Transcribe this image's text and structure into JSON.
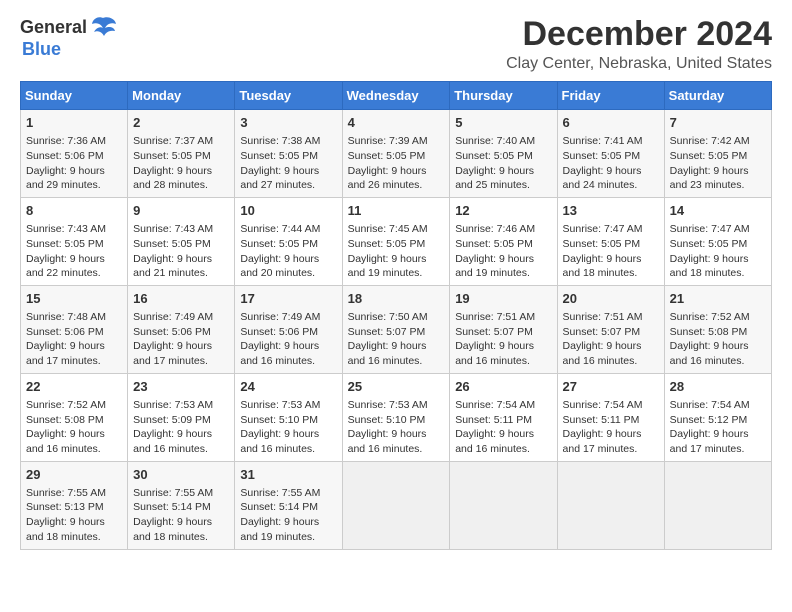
{
  "logo": {
    "general": "General",
    "blue": "Blue"
  },
  "title": "December 2024",
  "subtitle": "Clay Center, Nebraska, United States",
  "calendar": {
    "headers": [
      "Sunday",
      "Monday",
      "Tuesday",
      "Wednesday",
      "Thursday",
      "Friday",
      "Saturday"
    ],
    "weeks": [
      [
        {
          "day": "1",
          "sunrise": "7:36 AM",
          "sunset": "5:06 PM",
          "daylight": "9 hours and 29 minutes."
        },
        {
          "day": "2",
          "sunrise": "7:37 AM",
          "sunset": "5:05 PM",
          "daylight": "9 hours and 28 minutes."
        },
        {
          "day": "3",
          "sunrise": "7:38 AM",
          "sunset": "5:05 PM",
          "daylight": "9 hours and 27 minutes."
        },
        {
          "day": "4",
          "sunrise": "7:39 AM",
          "sunset": "5:05 PM",
          "daylight": "9 hours and 26 minutes."
        },
        {
          "day": "5",
          "sunrise": "7:40 AM",
          "sunset": "5:05 PM",
          "daylight": "9 hours and 25 minutes."
        },
        {
          "day": "6",
          "sunrise": "7:41 AM",
          "sunset": "5:05 PM",
          "daylight": "9 hours and 24 minutes."
        },
        {
          "day": "7",
          "sunrise": "7:42 AM",
          "sunset": "5:05 PM",
          "daylight": "9 hours and 23 minutes."
        }
      ],
      [
        {
          "day": "8",
          "sunrise": "7:43 AM",
          "sunset": "5:05 PM",
          "daylight": "9 hours and 22 minutes."
        },
        {
          "day": "9",
          "sunrise": "7:43 AM",
          "sunset": "5:05 PM",
          "daylight": "9 hours and 21 minutes."
        },
        {
          "day": "10",
          "sunrise": "7:44 AM",
          "sunset": "5:05 PM",
          "daylight": "9 hours and 20 minutes."
        },
        {
          "day": "11",
          "sunrise": "7:45 AM",
          "sunset": "5:05 PM",
          "daylight": "9 hours and 19 minutes."
        },
        {
          "day": "12",
          "sunrise": "7:46 AM",
          "sunset": "5:05 PM",
          "daylight": "9 hours and 19 minutes."
        },
        {
          "day": "13",
          "sunrise": "7:47 AM",
          "sunset": "5:05 PM",
          "daylight": "9 hours and 18 minutes."
        },
        {
          "day": "14",
          "sunrise": "7:47 AM",
          "sunset": "5:05 PM",
          "daylight": "9 hours and 18 minutes."
        }
      ],
      [
        {
          "day": "15",
          "sunrise": "7:48 AM",
          "sunset": "5:06 PM",
          "daylight": "9 hours and 17 minutes."
        },
        {
          "day": "16",
          "sunrise": "7:49 AM",
          "sunset": "5:06 PM",
          "daylight": "9 hours and 17 minutes."
        },
        {
          "day": "17",
          "sunrise": "7:49 AM",
          "sunset": "5:06 PM",
          "daylight": "9 hours and 16 minutes."
        },
        {
          "day": "18",
          "sunrise": "7:50 AM",
          "sunset": "5:07 PM",
          "daylight": "9 hours and 16 minutes."
        },
        {
          "day": "19",
          "sunrise": "7:51 AM",
          "sunset": "5:07 PM",
          "daylight": "9 hours and 16 minutes."
        },
        {
          "day": "20",
          "sunrise": "7:51 AM",
          "sunset": "5:07 PM",
          "daylight": "9 hours and 16 minutes."
        },
        {
          "day": "21",
          "sunrise": "7:52 AM",
          "sunset": "5:08 PM",
          "daylight": "9 hours and 16 minutes."
        }
      ],
      [
        {
          "day": "22",
          "sunrise": "7:52 AM",
          "sunset": "5:08 PM",
          "daylight": "9 hours and 16 minutes."
        },
        {
          "day": "23",
          "sunrise": "7:53 AM",
          "sunset": "5:09 PM",
          "daylight": "9 hours and 16 minutes."
        },
        {
          "day": "24",
          "sunrise": "7:53 AM",
          "sunset": "5:10 PM",
          "daylight": "9 hours and 16 minutes."
        },
        {
          "day": "25",
          "sunrise": "7:53 AM",
          "sunset": "5:10 PM",
          "daylight": "9 hours and 16 minutes."
        },
        {
          "day": "26",
          "sunrise": "7:54 AM",
          "sunset": "5:11 PM",
          "daylight": "9 hours and 16 minutes."
        },
        {
          "day": "27",
          "sunrise": "7:54 AM",
          "sunset": "5:11 PM",
          "daylight": "9 hours and 17 minutes."
        },
        {
          "day": "28",
          "sunrise": "7:54 AM",
          "sunset": "5:12 PM",
          "daylight": "9 hours and 17 minutes."
        }
      ],
      [
        {
          "day": "29",
          "sunrise": "7:55 AM",
          "sunset": "5:13 PM",
          "daylight": "9 hours and 18 minutes."
        },
        {
          "day": "30",
          "sunrise": "7:55 AM",
          "sunset": "5:14 PM",
          "daylight": "9 hours and 18 minutes."
        },
        {
          "day": "31",
          "sunrise": "7:55 AM",
          "sunset": "5:14 PM",
          "daylight": "9 hours and 19 minutes."
        },
        null,
        null,
        null,
        null
      ]
    ]
  }
}
